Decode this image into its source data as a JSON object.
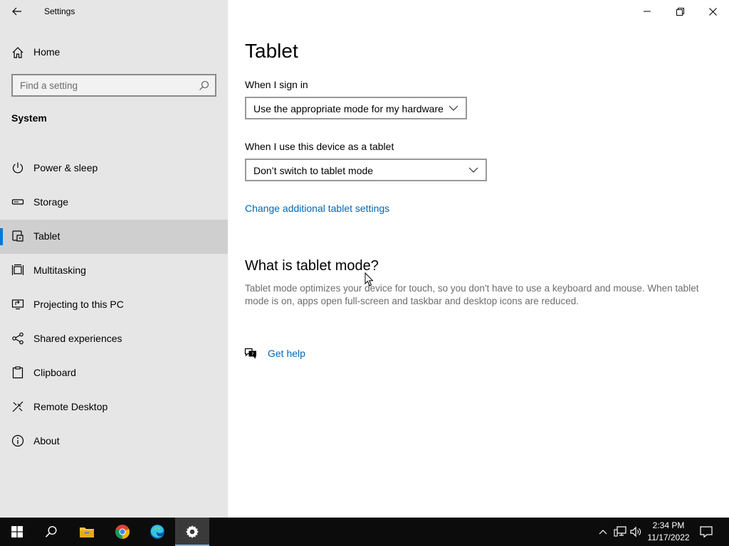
{
  "window": {
    "title": "Settings"
  },
  "sidebar": {
    "home_label": "Home",
    "search_placeholder": "Find a setting",
    "section_title": "System",
    "items": [
      {
        "label": "Power & sleep",
        "icon": "power-icon"
      },
      {
        "label": "Storage",
        "icon": "storage-icon"
      },
      {
        "label": "Tablet",
        "icon": "tablet-icon",
        "selected": true
      },
      {
        "label": "Multitasking",
        "icon": "multitasking-icon"
      },
      {
        "label": "Projecting to this PC",
        "icon": "projecting-icon"
      },
      {
        "label": "Shared experiences",
        "icon": "shared-experiences-icon"
      },
      {
        "label": "Clipboard",
        "icon": "clipboard-icon"
      },
      {
        "label": "Remote Desktop",
        "icon": "remote-desktop-icon"
      },
      {
        "label": "About",
        "icon": "info-icon"
      }
    ]
  },
  "main": {
    "title": "Tablet",
    "sign_in_label": "When I sign in",
    "sign_in_value": "Use the appropriate mode for my hardware",
    "tablet_use_label": "When I use this device as a tablet",
    "tablet_use_value": "Don’t switch to tablet mode",
    "additional_link": "Change additional tablet settings",
    "what_is_heading": "What is tablet mode?",
    "what_is_text": "Tablet mode optimizes your device for touch, so you don't have to use a keyboard and mouse. When tablet mode is on, apps open full-screen and taskbar and desktop icons are reduced.",
    "help_link": "Get help"
  },
  "taskbar": {
    "time": "2:34 PM",
    "date": "11/17/2022",
    "apps": [
      "start-icon",
      "search-icon",
      "file-explorer-icon",
      "chrome-icon",
      "edge-icon",
      "settings-icon"
    ],
    "tray": [
      "chevron-up-icon",
      "network-icon",
      "volume-icon",
      "notification-icon"
    ]
  },
  "colors": {
    "accent": "#0078d7",
    "link": "#0067b8",
    "sidebar_bg": "#e6e6e6",
    "taskbar_bg": "#0c0c0c"
  }
}
